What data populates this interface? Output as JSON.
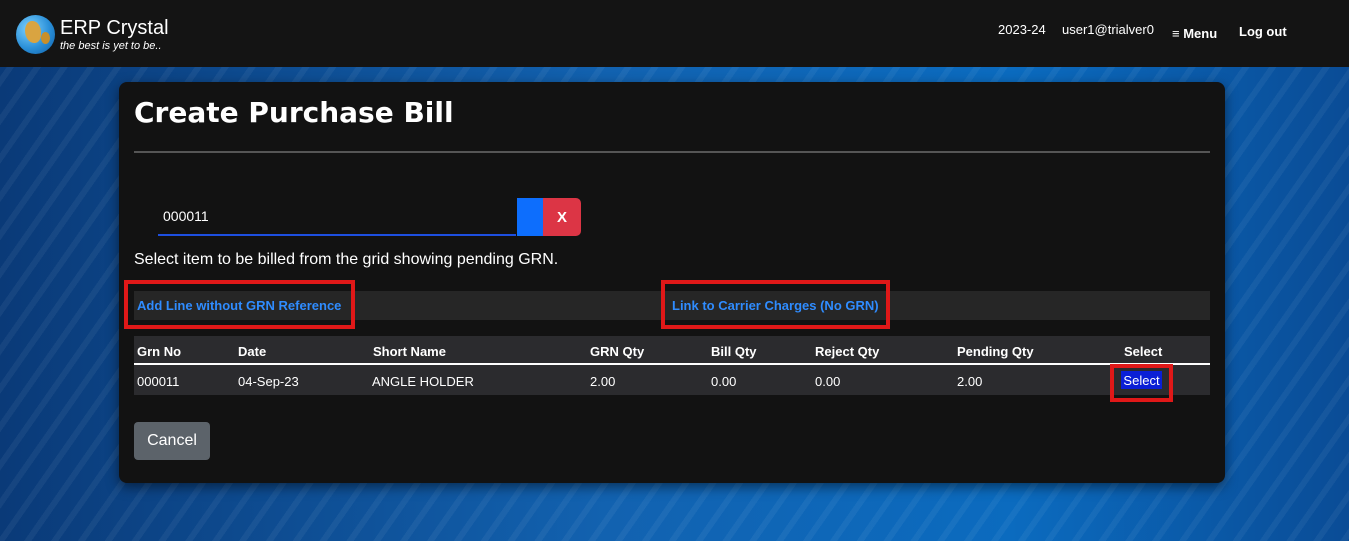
{
  "header": {
    "app_name": "ERP Crystal",
    "tagline": "the best is yet to be..",
    "fiscal_year": "2023-24",
    "user": "user1@trialver0",
    "menu_label": "≡ Menu",
    "logout_label": "Log out"
  },
  "page": {
    "title": "Create Purchase Bill",
    "grn_value": "000011",
    "clear_label": "X",
    "instructions": "Select item to be billed from the grid showing pending GRN.",
    "add_line_label": "Add Line without GRN Reference",
    "carrier_link_label": "Link to Carrier Charges (No GRN)",
    "cancel_label": "Cancel"
  },
  "grid": {
    "columns": [
      "Grn No",
      "Date",
      "Short Name",
      "GRN Qty",
      "Bill Qty",
      "Reject Qty",
      "Pending Qty",
      "Select"
    ],
    "rows": [
      {
        "grn_no": "000011",
        "date": "04-Sep-23",
        "short_name": "ANGLE HOLDER",
        "grn_qty": "2.00",
        "bill_qty": "0.00",
        "reject_qty": "0.00",
        "pending_qty": "2.00",
        "select_label": "Select"
      }
    ]
  },
  "colors": {
    "accent_link": "#2f8cff",
    "highlight": "#e01818",
    "danger": "#dc3545",
    "primary": "#0d6efd"
  }
}
